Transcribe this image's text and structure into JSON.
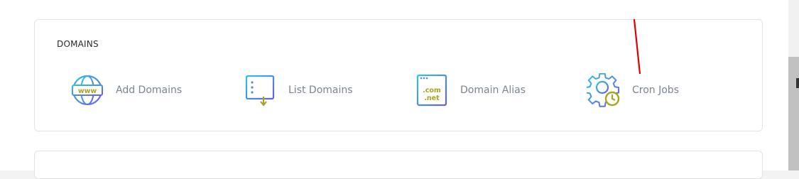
{
  "section": {
    "title": "DOMAINS"
  },
  "tiles": [
    {
      "label": "Add Domains",
      "icon": "globe-www-icon"
    },
    {
      "label": "List Domains",
      "icon": "list-document-icon"
    },
    {
      "label": "Domain Alias",
      "icon": "com-net-window-icon"
    },
    {
      "label": "Cron Jobs",
      "icon": "gear-clock-icon"
    }
  ],
  "icon_text": {
    "www": "www",
    "com": ".com",
    "net": ".net"
  },
  "colors": {
    "icon_gradient_start": "#2ec1e8",
    "icon_gradient_end": "#6a5ee0",
    "accent_olive": "#a7a51f",
    "label": "#7b8494",
    "annotation": "#e00000"
  }
}
